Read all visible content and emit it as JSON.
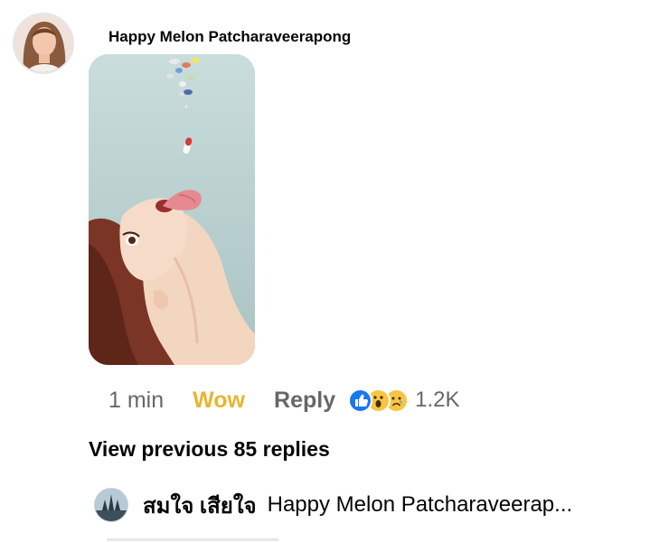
{
  "comment": {
    "author": "Happy Melon Patcharaveerapong",
    "image_description": "illustration of a woman with tongue out catching falling pills",
    "time": "1 min",
    "reaction_label": "Wow",
    "reply_label": "Reply",
    "reactions": [
      "like-icon",
      "wow-icon",
      "sad-icon"
    ],
    "reaction_count": "1.2K"
  },
  "view_previous": "View previous 85 replies",
  "reply": {
    "name": "สมใจ เสียใจ",
    "text": "Happy Melon Patcharaveerap..."
  },
  "colors": {
    "wow_accent": "#e8b531",
    "like_blue": "#1877f2",
    "muted": "#65676b"
  }
}
